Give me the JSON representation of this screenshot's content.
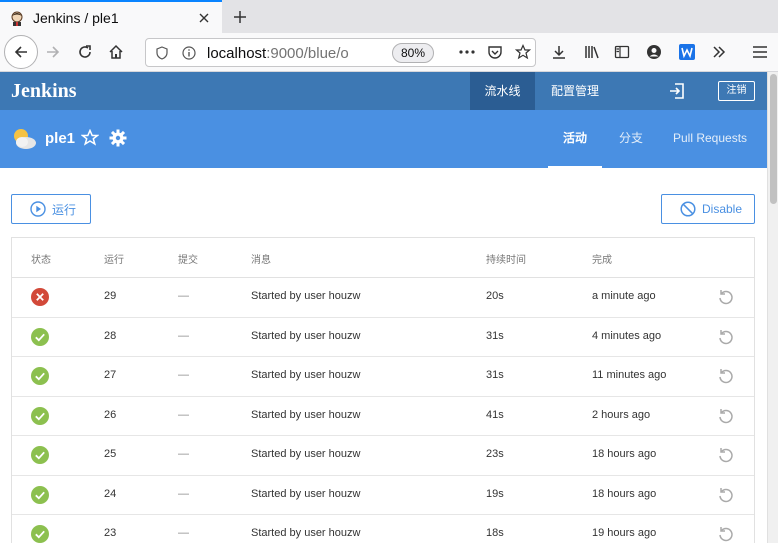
{
  "browser": {
    "tab_title": "Jenkins / ple1",
    "url_host": "localhost",
    "url_rest": ":9000/blue/o",
    "zoom": "80%"
  },
  "jenkins": {
    "logo": "Jenkins",
    "nav_pipelines": "流水线",
    "nav_admin": "配置管理",
    "logout": "注销"
  },
  "pipeline": {
    "name": "ple1",
    "tabs": [
      "活动",
      "分支",
      "Pull Requests"
    ]
  },
  "actions": {
    "run": "运行",
    "disable": "Disable"
  },
  "table": {
    "headers": [
      "状态",
      "运行",
      "提交",
      "消息",
      "持续时间",
      "完成"
    ],
    "rows": [
      {
        "status": "failed",
        "run": "29",
        "commit": "—",
        "message": "Started by user houzw",
        "duration": "20s",
        "completed": "a minute ago"
      },
      {
        "status": "success",
        "run": "28",
        "commit": "—",
        "message": "Started by user houzw",
        "duration": "31s",
        "completed": "4 minutes ago"
      },
      {
        "status": "success",
        "run": "27",
        "commit": "—",
        "message": "Started by user houzw",
        "duration": "31s",
        "completed": "11 minutes ago"
      },
      {
        "status": "success",
        "run": "26",
        "commit": "—",
        "message": "Started by user houzw",
        "duration": "41s",
        "completed": "2 hours ago"
      },
      {
        "status": "success",
        "run": "25",
        "commit": "—",
        "message": "Started by user houzw",
        "duration": "23s",
        "completed": "18 hours ago"
      },
      {
        "status": "success",
        "run": "24",
        "commit": "—",
        "message": "Started by user houzw",
        "duration": "19s",
        "completed": "18 hours ago"
      },
      {
        "status": "success",
        "run": "23",
        "commit": "—",
        "message": "Started by user houzw",
        "duration": "18s",
        "completed": "19 hours ago"
      }
    ]
  },
  "colors": {
    "failed": "#d24939",
    "success": "#8cc04f",
    "accent": "#4a90e2"
  }
}
